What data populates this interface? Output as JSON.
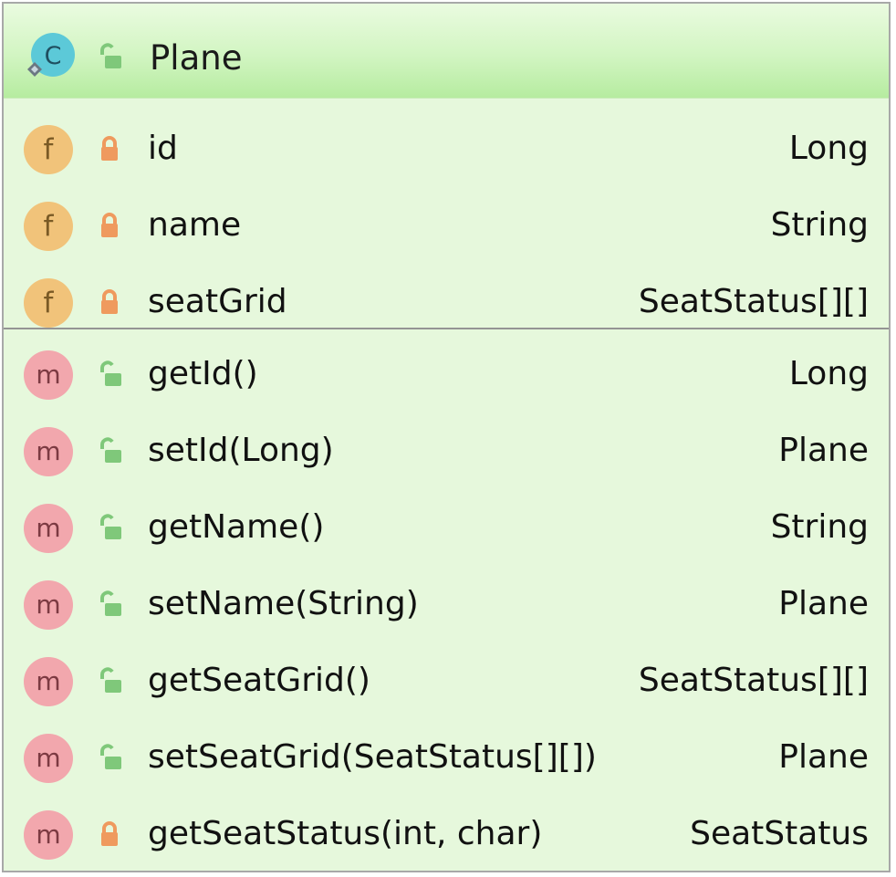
{
  "class": {
    "name": "Plane",
    "kind_letter": "C",
    "icons": {
      "class": "class-icon",
      "visibility": "public-lock-icon"
    }
  },
  "fields": [
    {
      "letter": "f",
      "visibility": "private",
      "name": "id",
      "type": "Long"
    },
    {
      "letter": "f",
      "visibility": "private",
      "name": "name",
      "type": "String"
    },
    {
      "letter": "f",
      "visibility": "private",
      "name": "seatGrid",
      "type": "SeatStatus[][]"
    }
  ],
  "methods": [
    {
      "letter": "m",
      "visibility": "public",
      "name": "getId()",
      "type": "Long"
    },
    {
      "letter": "m",
      "visibility": "public",
      "name": "setId(Long)",
      "type": "Plane"
    },
    {
      "letter": "m",
      "visibility": "public",
      "name": "getName()",
      "type": "String"
    },
    {
      "letter": "m",
      "visibility": "public",
      "name": "setName(String)",
      "type": "Plane"
    },
    {
      "letter": "m",
      "visibility": "public",
      "name": "getSeatGrid()",
      "type": "SeatStatus[][]"
    },
    {
      "letter": "m",
      "visibility": "public",
      "name": "setSeatGrid(SeatStatus[][])",
      "type": "Plane"
    },
    {
      "letter": "m",
      "visibility": "private",
      "name": "getSeatStatus(int, char)",
      "type": "SeatStatus"
    }
  ],
  "colors": {
    "header": "#b6eca0",
    "body": "#e6f8dc",
    "field_badge": "#f1c37a",
    "method_badge": "#f2a7ad",
    "public_lock": "#7fc87a",
    "private_lock": "#ef9a5e"
  }
}
